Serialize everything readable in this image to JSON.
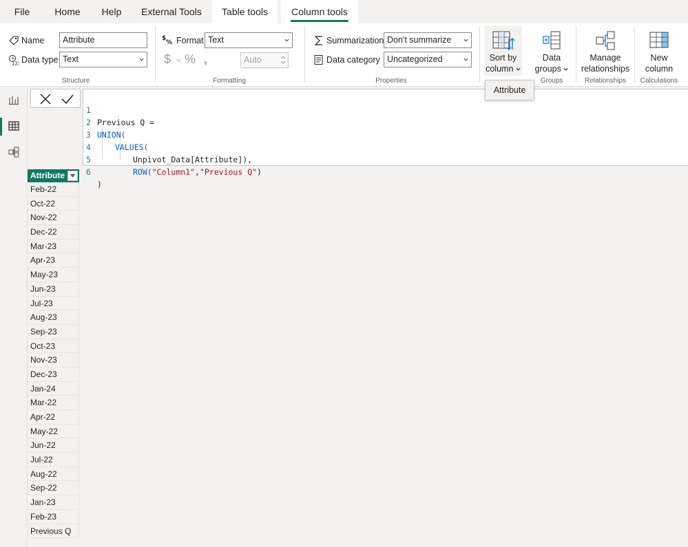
{
  "menu": {
    "tabs": [
      {
        "label": "File"
      },
      {
        "label": "Home"
      },
      {
        "label": "Help"
      },
      {
        "label": "External Tools"
      },
      {
        "label": "Table tools"
      },
      {
        "label": "Column tools"
      }
    ],
    "active_tab": "Column tools"
  },
  "ribbon": {
    "structure": {
      "group_label": "Structure",
      "name_label": "Name",
      "name_value": "Attribute",
      "datatype_label": "Data type",
      "datatype_value": "Text"
    },
    "formatting": {
      "group_label": "Formatting",
      "format_label": "Format",
      "format_value": "Text",
      "decimal_value": "Auto"
    },
    "properties": {
      "group_label": "Properties",
      "summarization_label": "Summarization",
      "summarization_value": "Don't summarize",
      "category_label": "Data category",
      "category_value": "Uncategorized"
    },
    "sort": {
      "line1": "Sort by",
      "line2": "column"
    },
    "groups": {
      "line1": "Data",
      "line2": "groups",
      "group_label": "Groups"
    },
    "relationships": {
      "line1": "Manage",
      "line2": "relationships",
      "group_label": "Relationships"
    },
    "calculations": {
      "line1": "New",
      "line2": "column",
      "group_label": "Calculations"
    }
  },
  "tooltip": {
    "text": "Attribute"
  },
  "formula": {
    "lines": [
      {
        "num": "1",
        "text": "Previous Q ="
      },
      {
        "num": "2",
        "text": "UNION("
      },
      {
        "num": "3",
        "text": "VALUES("
      },
      {
        "num": "4",
        "text": "Unpivot_Data[Attribute]),"
      },
      {
        "num": "5a",
        "text": "ROW(",
        "num_display": "5"
      },
      {
        "num": "5b",
        "text": "\"Column1\""
      },
      {
        "num": "5c",
        "text": ","
      },
      {
        "num": "5d",
        "text": "\"Previous Q\""
      },
      {
        "num": "5e",
        "text": ")"
      },
      {
        "num": "6",
        "text": ")"
      }
    ]
  },
  "table": {
    "header": "Attribute",
    "rows": [
      "Feb-22",
      "Oct-22",
      "Nov-22",
      "Dec-22",
      "Mar-23",
      "Apr-23",
      "May-23",
      "Jun-23",
      "Jul-23",
      "Aug-23",
      "Sep-23",
      "Oct-23",
      "Nov-23",
      "Dec-23",
      "Jan-24",
      "Mar-22",
      "Apr-22",
      "May-22",
      "Jun-22",
      "Jul-22",
      "Aug-22",
      "Sep-22",
      "Jan-23",
      "Feb-23",
      "Previous Q"
    ]
  },
  "colors": {
    "accent": "#117865",
    "keyword": "#035aca",
    "string": "#a31515"
  }
}
